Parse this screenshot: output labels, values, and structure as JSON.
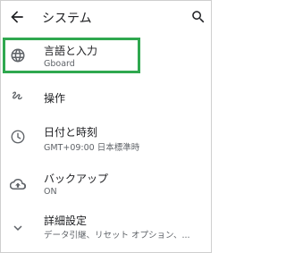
{
  "appbar": {
    "title": "システム",
    "back_icon": "arrow-back-icon",
    "search_icon": "search-icon"
  },
  "items": [
    {
      "icon": "globe-icon",
      "label": "言語と入力",
      "sub": "Gboard"
    },
    {
      "icon": "gesture-icon",
      "label": "操作",
      "sub": ""
    },
    {
      "icon": "clock-icon",
      "label": "日付と時刻",
      "sub": "GMT+09:00 日本標準時"
    },
    {
      "icon": "cloud-upload-icon",
      "label": "バックアップ",
      "sub": "ON"
    },
    {
      "icon": "chevron-down-icon",
      "label": "詳細設定",
      "sub": "データ引継、リセット オプション、..."
    }
  ],
  "colors": {
    "highlight": "#2fa84f",
    "text_primary": "#202124",
    "text_secondary": "#5f6368"
  }
}
